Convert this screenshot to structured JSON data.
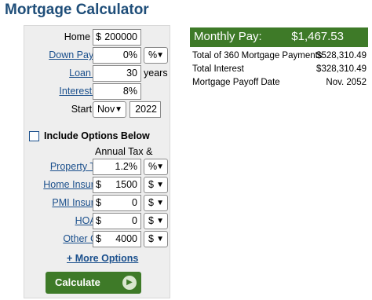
{
  "title": "Mortgage Calculator",
  "form": {
    "home_price": {
      "label": "Home Price",
      "currency": "$",
      "value": "200000"
    },
    "down_payment": {
      "label": "Down Payment",
      "value": "0%",
      "unit_option": "%"
    },
    "loan_term": {
      "label": "Loan Term",
      "value": "30",
      "unit": "years"
    },
    "interest_rate": {
      "label": "Interest Rate",
      "value": "8%"
    },
    "start_date": {
      "label": "Start Date",
      "month": "Nov",
      "year": "2022"
    },
    "include_options": {
      "label": "Include Options Below",
      "checked": false
    },
    "section_heading": "Annual Tax & Cost",
    "property_taxes": {
      "label": "Property Taxes",
      "value": "1.2%",
      "unit_option": "%"
    },
    "home_insurance": {
      "label": "Home Insurance",
      "currency": "$",
      "value": "1500",
      "unit_option": "$"
    },
    "pmi_insurance": {
      "label": "PMI Insurance",
      "currency": "$",
      "value": "0",
      "unit_option": "$"
    },
    "hoa_fee": {
      "label": "HOA Fee",
      "currency": "$",
      "value": "0",
      "unit_option": "$"
    },
    "other_costs": {
      "label": "Other Costs",
      "currency": "$",
      "value": "4000",
      "unit_option": "$"
    },
    "more_options": "+ More Options",
    "calculate": "Calculate"
  },
  "results": {
    "monthly_label": "Monthly Pay:",
    "monthly_amount": "$1,467.53",
    "rows": [
      {
        "label": "Total of 360 Mortgage Payments",
        "value": "$528,310.49"
      },
      {
        "label": "Total Interest",
        "value": "$328,310.49"
      },
      {
        "label": "Mortgage Payoff Date",
        "value": "Nov. 2052"
      }
    ]
  },
  "colors": {
    "brand_blue": "#1f4e79",
    "link_blue": "#1a4f8c",
    "accent_green": "#3e7a28"
  },
  "icons": {
    "select_chevron": "chevron-down-icon",
    "calculate_arrow": "play-arrow-icon"
  }
}
